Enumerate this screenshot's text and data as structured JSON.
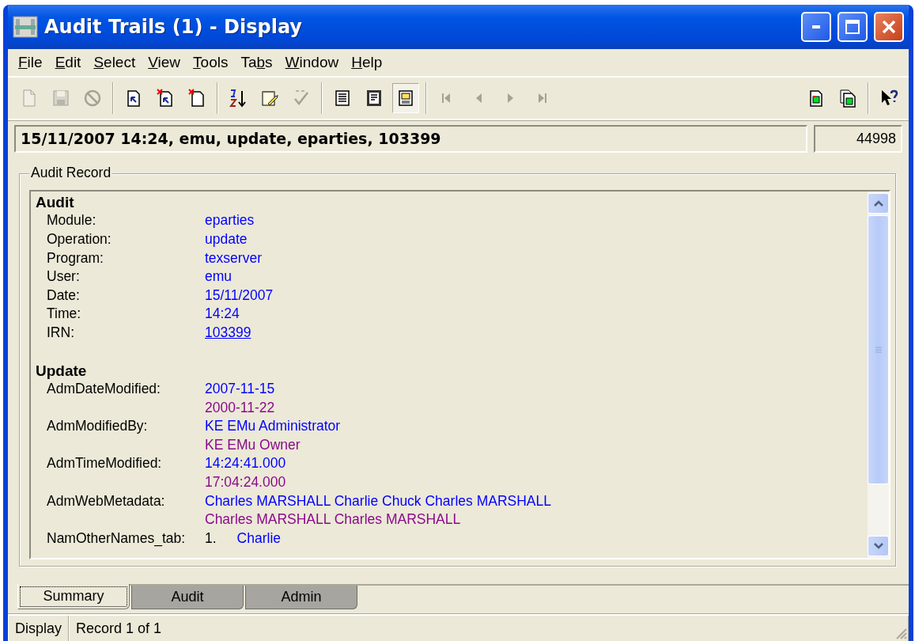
{
  "window": {
    "title": "Audit Trails (1) - Display"
  },
  "menu": [
    {
      "label": "File"
    },
    {
      "label": "Edit"
    },
    {
      "label": "Select"
    },
    {
      "label": "View"
    },
    {
      "label": "Tools"
    },
    {
      "label": "Tabs"
    },
    {
      "label": "Window"
    },
    {
      "label": "Help"
    }
  ],
  "toolbar": [
    [
      {
        "kind": "new",
        "disabled": true,
        "selected": false
      },
      {
        "kind": "save",
        "disabled": true,
        "selected": false
      },
      {
        "kind": "cancel",
        "disabled": true,
        "selected": false
      }
    ],
    [
      {
        "kind": "doc-arrow",
        "disabled": false,
        "selected": false
      },
      {
        "kind": "doc-arrow-x",
        "disabled": false,
        "selected": false
      },
      {
        "kind": "doc-x",
        "disabled": false,
        "selected": false
      }
    ],
    [
      {
        "kind": "sort",
        "disabled": false,
        "selected": false
      },
      {
        "kind": "notepad",
        "disabled": false,
        "selected": false
      },
      {
        "kind": "spell",
        "disabled": true,
        "selected": false
      }
    ],
    [
      {
        "kind": "list",
        "disabled": false,
        "selected": false
      },
      {
        "kind": "details",
        "disabled": false,
        "selected": false
      },
      {
        "kind": "image",
        "disabled": false,
        "selected": true
      }
    ],
    [
      {
        "kind": "first",
        "disabled": true,
        "selected": false
      },
      {
        "kind": "prev",
        "disabled": true,
        "selected": false
      },
      {
        "kind": "next",
        "disabled": true,
        "selected": false
      },
      {
        "kind": "last",
        "disabled": true,
        "selected": false
      }
    ]
  ],
  "toolbar_right": [
    [
      {
        "kind": "doc-green",
        "disabled": false,
        "selected": false
      },
      {
        "kind": "docs-green",
        "disabled": false,
        "selected": false
      }
    ],
    [
      {
        "kind": "help",
        "disabled": false,
        "selected": false
      }
    ]
  ],
  "record_bar": {
    "summary": "15/11/2007 14:24, emu, update, eparties, 103399",
    "count": "44998"
  },
  "audit_record": {
    "title": "Audit Record",
    "sections": [
      {
        "title": "Audit",
        "fields": [
          {
            "label": "Module:",
            "values": [
              {
                "text": "eparties",
                "kind": "current"
              }
            ]
          },
          {
            "label": "Operation:",
            "values": [
              {
                "text": "update",
                "kind": "current"
              }
            ]
          },
          {
            "label": "Program:",
            "values": [
              {
                "text": "texserver",
                "kind": "current"
              }
            ]
          },
          {
            "label": "User:",
            "values": [
              {
                "text": "emu",
                "kind": "current"
              }
            ]
          },
          {
            "label": "Date:",
            "values": [
              {
                "text": "15/11/2007",
                "kind": "current"
              }
            ]
          },
          {
            "label": "Time:",
            "values": [
              {
                "text": "14:24",
                "kind": "current"
              }
            ]
          },
          {
            "label": "IRN:",
            "values": [
              {
                "text": "103399",
                "kind": "link"
              }
            ]
          }
        ]
      },
      {
        "title": "Update",
        "fields": [
          {
            "label": "AdmDateModified:",
            "values": [
              {
                "text": "2007-11-15",
                "kind": "current"
              },
              {
                "text": "2000-11-22",
                "kind": "previous"
              }
            ]
          },
          {
            "label": "AdmModifiedBy:",
            "values": [
              {
                "text": "KE EMu Administrator",
                "kind": "current"
              },
              {
                "text": "KE EMu Owner",
                "kind": "previous"
              }
            ]
          },
          {
            "label": "AdmTimeModified:",
            "values": [
              {
                "text": "14:24:41.000",
                "kind": "current"
              },
              {
                "text": "17:04:24.000",
                "kind": "previous"
              }
            ]
          },
          {
            "label": "AdmWebMetadata:",
            "values": [
              {
                "text": "Charles MARSHALL Charlie Chuck Charles MARSHALL",
                "kind": "current"
              },
              {
                "text": "Charles MARSHALL Charles MARSHALL",
                "kind": "previous"
              }
            ]
          },
          {
            "label": "NamOtherNames_tab:",
            "values": [
              {
                "index": "1.",
                "text": "Charlie",
                "kind": "current"
              }
            ]
          }
        ]
      }
    ]
  },
  "tabs": [
    {
      "label": "Summary",
      "selected": true
    },
    {
      "label": "Audit",
      "selected": false
    },
    {
      "label": "Admin",
      "selected": false
    }
  ],
  "status_bar": [
    {
      "text": "Display"
    },
    {
      "text": "Record 1 of 1"
    }
  ]
}
